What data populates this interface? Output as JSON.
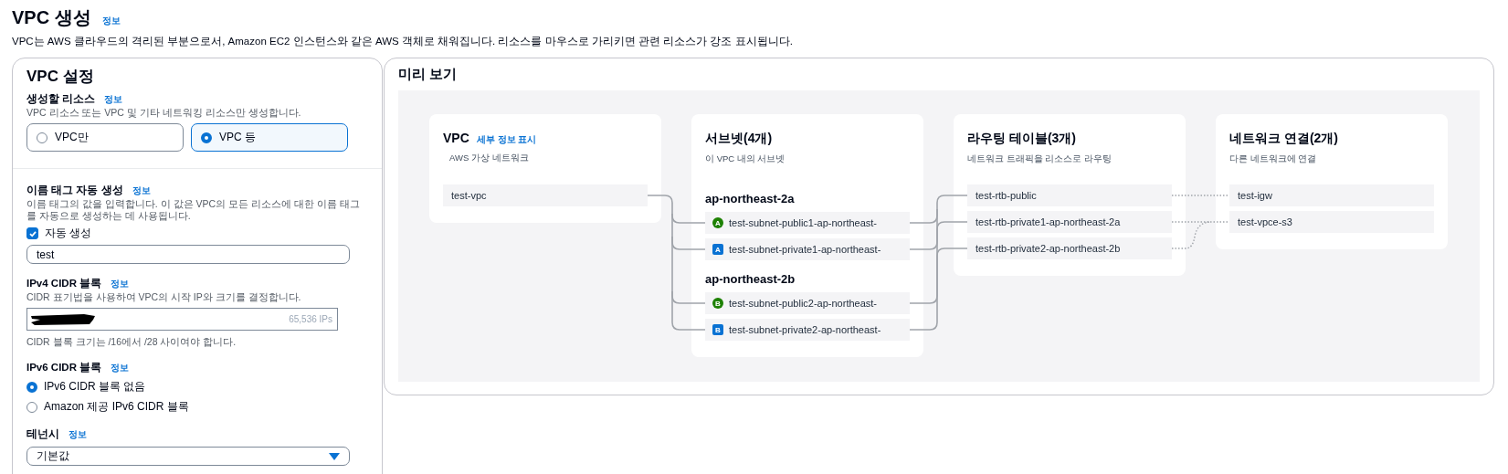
{
  "page": {
    "title": "VPC 생성",
    "info_link": "정보",
    "description": "VPC는 AWS 클라우드의 격리된 부분으로서, Amazon EC2 인스턴스와 같은 AWS 객체로 채워집니다. 리소스를 마우스로 가리키면 관련 리소스가 강조 표시됩니다."
  },
  "settings": {
    "title": "VPC 설정",
    "resources": {
      "label": "생성할 리소스",
      "info_link": "정보",
      "description": "VPC 리소스 또는 VPC 및 기타 네트워킹 리소스만 생성합니다.",
      "options": [
        {
          "label": "VPC만",
          "selected": false
        },
        {
          "label": "VPC 등",
          "selected": true
        }
      ]
    },
    "name_tag": {
      "label": "이름 태그 자동 생성",
      "info_link": "정보",
      "description": "이름 태그의 값을 입력합니다. 이 값은 VPC의 모든 리소스에 대한 이름 태그를 자동으로 생성하는 데 사용됩니다.",
      "checkbox": {
        "label": "자동 생성",
        "checked": true
      },
      "value": "test"
    },
    "ipv4": {
      "label": "IPv4 CIDR 블록",
      "info_link": "정보",
      "description": "CIDR 표기법을 사용하여 VPC의 시작 IP와 크기를 결정합니다.",
      "suffix": "65,536 IPs",
      "hint": "CIDR 블록 크기는 /16에서 /28 사이여야 합니다."
    },
    "ipv6": {
      "label": "IPv6 CIDR 블록",
      "info_link": "정보",
      "options": [
        {
          "label": "IPv6 CIDR 블록 없음",
          "selected": true
        },
        {
          "label": "Amazon 제공 IPv6 CIDR 블록",
          "selected": false
        }
      ]
    },
    "tenancy": {
      "label": "테넌시",
      "info_link": "정보",
      "value": "기본값"
    }
  },
  "preview": {
    "title": "미리 보기",
    "vpc": {
      "title": "VPC",
      "link": "세부 정보 표시",
      "description": "AWS 가상 네트워크",
      "items": [
        "test-vpc"
      ]
    },
    "subnets": {
      "title": "서브넷(4개)",
      "description": "이 VPC 내의 서브넷",
      "groups": [
        {
          "zone": "ap-northeast-2a",
          "items": [
            {
              "badge": "A",
              "kind": "public",
              "name": "test-subnet-public1-ap-northeast-"
            },
            {
              "badge": "A",
              "kind": "private",
              "name": "test-subnet-private1-ap-northeast-"
            }
          ]
        },
        {
          "zone": "ap-northeast-2b",
          "items": [
            {
              "badge": "B",
              "kind": "public",
              "name": "test-subnet-public2-ap-northeast-"
            },
            {
              "badge": "B",
              "kind": "private",
              "name": "test-subnet-private2-ap-northeast-"
            }
          ]
        }
      ]
    },
    "route_tables": {
      "title": "라우팅 테이블(3개)",
      "description": "네트워크 트래픽을 리소스로 라우팅",
      "items": [
        "test-rtb-public",
        "test-rtb-private1-ap-northeast-2a",
        "test-rtb-private2-ap-northeast-2b"
      ]
    },
    "connections": {
      "title": "네트워크 연결(2개)",
      "description": "다른 네트워크에 연결",
      "items": [
        "test-igw",
        "test-vpce-s3"
      ]
    }
  }
}
